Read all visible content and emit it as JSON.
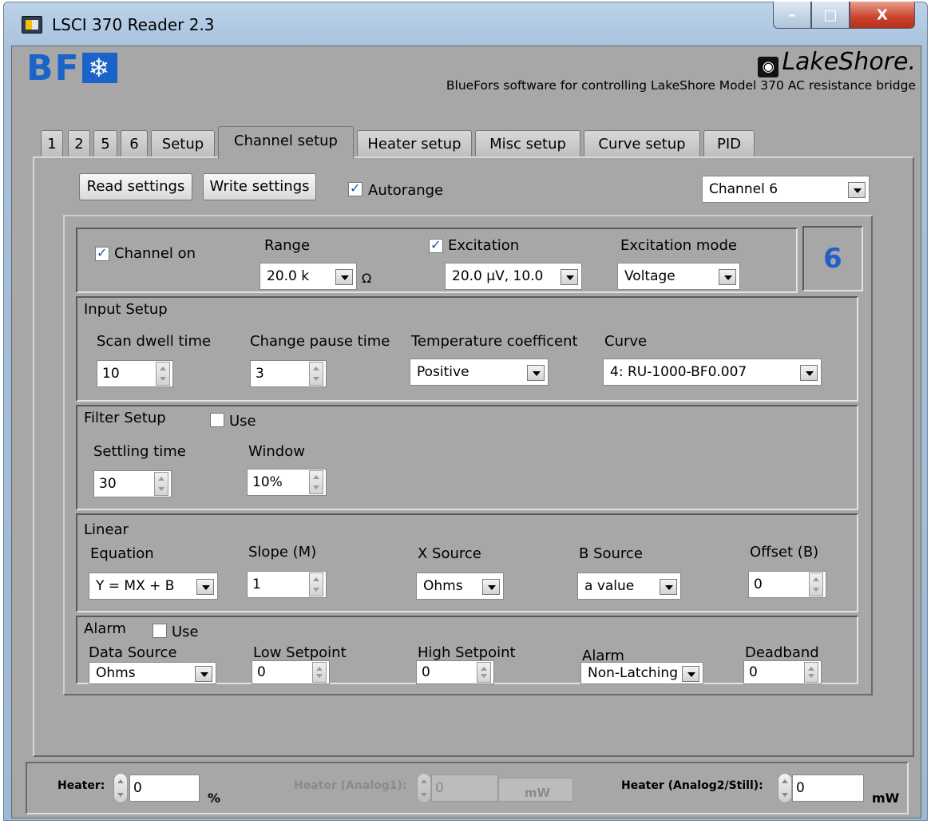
{
  "window": {
    "title": "LSCI 370 Reader 2.3",
    "min": "–",
    "max": "□",
    "close": "X"
  },
  "header": {
    "bf_logo": "BF",
    "bf_snow": "❄",
    "lakeshore_logo": "LakeShore.",
    "subtitle": "BlueFors software for controlling LakeShore Model 370 AC resistance bridge"
  },
  "tabs": [
    "1",
    "2",
    "5",
    "6",
    "Setup",
    "Channel setup",
    "Heater setup",
    "Misc setup",
    "Curve setup",
    "PID"
  ],
  "active_tab": "Channel setup",
  "toolbar": {
    "read_label": "Read settings",
    "write_label": "Write settings",
    "autorange_label": "Autorange",
    "autorange_checked": true,
    "channel_select": "Channel 6"
  },
  "channel": {
    "on_label": "Channel on",
    "on_checked": true,
    "range_label": "Range",
    "range_value": "20.0 k",
    "range_unit": "Ω",
    "excitation_label": "Excitation",
    "excitation_checked": true,
    "excitation_value": "20.0 μV, 10.0",
    "mode_label": "Excitation mode",
    "mode_value": "Voltage",
    "number": "6"
  },
  "input_setup": {
    "title": "Input Setup",
    "dwell_label": "Scan dwell time",
    "dwell_value": "10",
    "pause_label": "Change pause time",
    "pause_value": "3",
    "tempco_label": "Temperature coefficent",
    "tempco_value": "Positive",
    "curve_label": "Curve",
    "curve_value": "4: RU-1000-BF0.007"
  },
  "filter_setup": {
    "title": "Filter Setup",
    "use_label": "Use",
    "use_checked": false,
    "settling_label": "Settling time",
    "settling_value": "30",
    "window_label": "Window",
    "window_value": "10%"
  },
  "linear": {
    "title": "Linear",
    "equation_label": "Equation",
    "equation_value": "Y = MX + B",
    "slope_label": "Slope (M)",
    "slope_value": "1",
    "xsource_label": "X Source",
    "xsource_value": "Ohms",
    "bsource_label": "B Source",
    "bsource_value": "a value",
    "offset_label": "Offset (B)",
    "offset_value": "0"
  },
  "alarm": {
    "title": "Alarm",
    "use_label": "Use",
    "use_checked": false,
    "datasource_label": "Data Source",
    "datasource_value": "Ohms",
    "low_label": "Low Setpoint",
    "low_value": "0",
    "high_label": "High Setpoint",
    "high_value": "0",
    "alarm_label": "Alarm",
    "alarm_value": "Non-Latching",
    "deadband_label": "Deadband",
    "deadband_value": "0"
  },
  "status": {
    "heater_label": "Heater:",
    "heater_value": "0",
    "heater_unit": "%",
    "analog1_label": "Heater (Analog1):",
    "analog1_value": "0",
    "analog1_unit": "mW",
    "analog2_label": "Heater (Analog2/Still):",
    "analog2_value": "0",
    "analog2_unit": "mW"
  }
}
